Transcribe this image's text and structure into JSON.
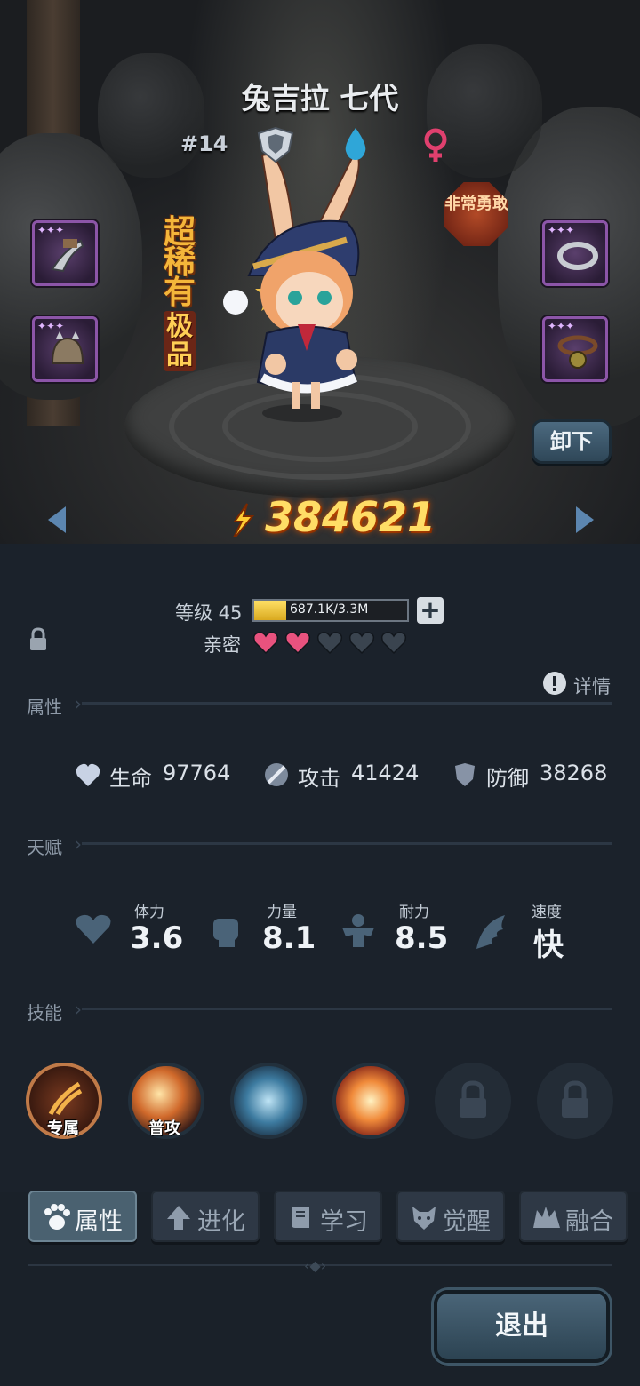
{
  "character": {
    "name": "兔吉拉 七代",
    "id_number": "#14",
    "rarity": "超稀有",
    "quality": "极品",
    "personality": "非常勇敢",
    "power": "384621",
    "icons": [
      "shield-rank-icon",
      "water-element-icon",
      "female-gender-icon"
    ]
  },
  "equipment": {
    "left": [
      "claw-weapon",
      "spiked-helmet"
    ],
    "right": [
      "ring-accessory",
      "collar-accessory"
    ]
  },
  "buttons": {
    "unequip": "卸下",
    "exit": "退出"
  },
  "level": {
    "label": "等级 45",
    "exp_text": "687.1K/3.3M",
    "exp_fraction": 0.21
  },
  "intimacy": {
    "label": "亲密",
    "filled": 2,
    "total": 5
  },
  "sections": {
    "attributes": "属性",
    "talent": "天赋",
    "skills": "技能",
    "detail": "详情"
  },
  "attributes": [
    {
      "label": "生命",
      "value": "97764",
      "icon": "heart-shield-icon"
    },
    {
      "label": "攻击",
      "value": "41424",
      "icon": "sword-icon"
    },
    {
      "label": "防御",
      "value": "38268",
      "icon": "shield-icon"
    }
  ],
  "talents": [
    {
      "label": "体力",
      "value": "3.6",
      "icon": "heart-icon"
    },
    {
      "label": "力量",
      "value": "8.1",
      "icon": "fist-icon"
    },
    {
      "label": "耐力",
      "value": "8.5",
      "icon": "muscle-icon"
    },
    {
      "label": "速度",
      "value": "快",
      "icon": "wing-icon"
    }
  ],
  "skills": [
    {
      "label": "专属",
      "state": "unlocked"
    },
    {
      "label": "普攻",
      "state": "unlocked"
    },
    {
      "label": "",
      "state": "unlocked"
    },
    {
      "label": "",
      "state": "unlocked"
    },
    {
      "label": "",
      "state": "locked"
    },
    {
      "label": "",
      "state": "locked"
    }
  ],
  "tabs": [
    {
      "label": "属性",
      "active": true
    },
    {
      "label": "进化",
      "active": false
    },
    {
      "label": "学习",
      "active": false
    },
    {
      "label": "觉醒",
      "active": false
    },
    {
      "label": "融合",
      "active": false
    }
  ],
  "colors": {
    "rarity": "#f4b63a",
    "power": "#ffdd66",
    "heart_filled": "#e8527e",
    "heart_empty": "#3a444f",
    "active_tab": "#4a6170"
  }
}
